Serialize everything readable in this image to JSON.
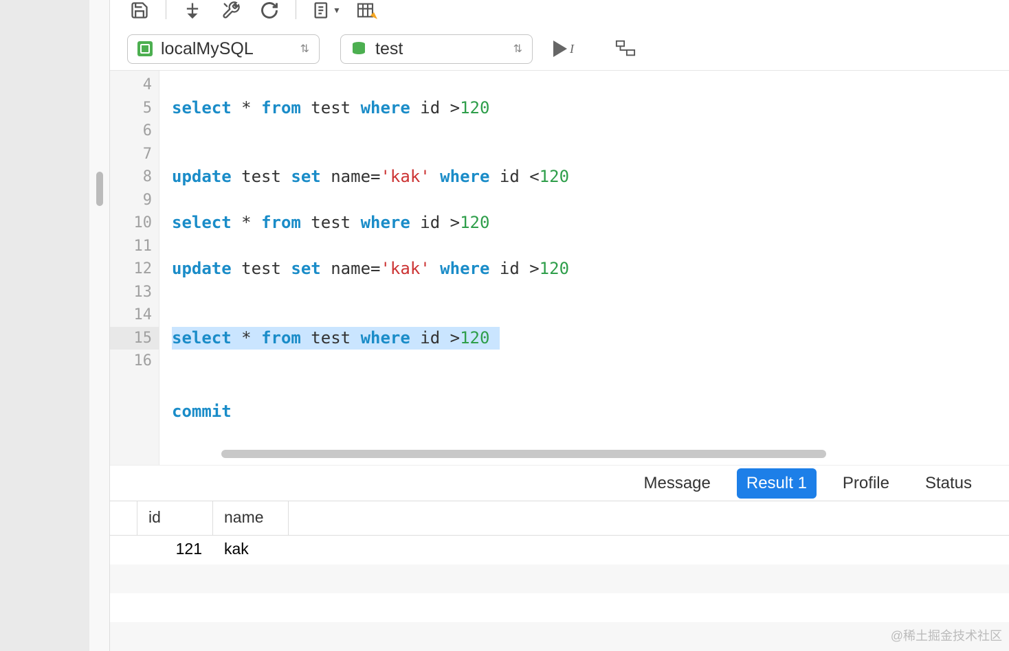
{
  "toolbar2": {
    "connection": "localMySQL",
    "database": "test"
  },
  "editor": {
    "lines": [
      {
        "n": 4,
        "tokens": []
      },
      {
        "n": 5,
        "tokens": [
          [
            "kw",
            "select"
          ],
          [
            " ",
            " * "
          ],
          [
            "kw",
            "from"
          ],
          [
            " ",
            " test "
          ],
          [
            "kw",
            "where"
          ],
          [
            " ",
            " id >"
          ],
          [
            "num",
            "120"
          ]
        ]
      },
      {
        "n": 6,
        "tokens": []
      },
      {
        "n": 7,
        "tokens": []
      },
      {
        "n": 8,
        "tokens": [
          [
            "kw",
            "update"
          ],
          [
            " ",
            " test "
          ],
          [
            "kw",
            "set"
          ],
          [
            " ",
            " name="
          ],
          [
            "str",
            "'kak'"
          ],
          [
            " ",
            " "
          ],
          [
            "kw",
            "where"
          ],
          [
            " ",
            " id <"
          ],
          [
            "num",
            "120"
          ]
        ]
      },
      {
        "n": 9,
        "tokens": []
      },
      {
        "n": 10,
        "tokens": [
          [
            "kw",
            "select"
          ],
          [
            " ",
            " * "
          ],
          [
            "kw",
            "from"
          ],
          [
            " ",
            " test "
          ],
          [
            "kw",
            "where"
          ],
          [
            " ",
            " id >"
          ],
          [
            "num",
            "120"
          ]
        ]
      },
      {
        "n": 11,
        "tokens": []
      },
      {
        "n": 12,
        "tokens": [
          [
            "kw",
            "update"
          ],
          [
            " ",
            " test "
          ],
          [
            "kw",
            "set"
          ],
          [
            " ",
            " name="
          ],
          [
            "str",
            "'kak'"
          ],
          [
            " ",
            " "
          ],
          [
            "kw",
            "where"
          ],
          [
            " ",
            " id >"
          ],
          [
            "num",
            "120"
          ]
        ]
      },
      {
        "n": 13,
        "tokens": []
      },
      {
        "n": 14,
        "tokens": []
      },
      {
        "n": 15,
        "selected": true,
        "highlight": true,
        "tokens": [
          [
            "kw",
            "select"
          ],
          [
            " ",
            " * "
          ],
          [
            "kw",
            "from"
          ],
          [
            " ",
            " test "
          ],
          [
            "kw",
            "where"
          ],
          [
            " ",
            " id >"
          ],
          [
            "num",
            "120 "
          ]
        ]
      },
      {
        "n": 16,
        "tokens": []
      }
    ],
    "footer": {
      "tokens": [
        [
          "kw",
          "commit"
        ]
      ]
    }
  },
  "tabs": [
    {
      "label": "Message",
      "active": false
    },
    {
      "label": "Result 1",
      "active": true
    },
    {
      "label": "Profile",
      "active": false
    },
    {
      "label": "Status",
      "active": false
    }
  ],
  "result": {
    "columns": [
      "id",
      "name"
    ],
    "rows": [
      {
        "id": "121",
        "name": "kak"
      }
    ]
  },
  "watermark": "@稀土掘金技术社区"
}
